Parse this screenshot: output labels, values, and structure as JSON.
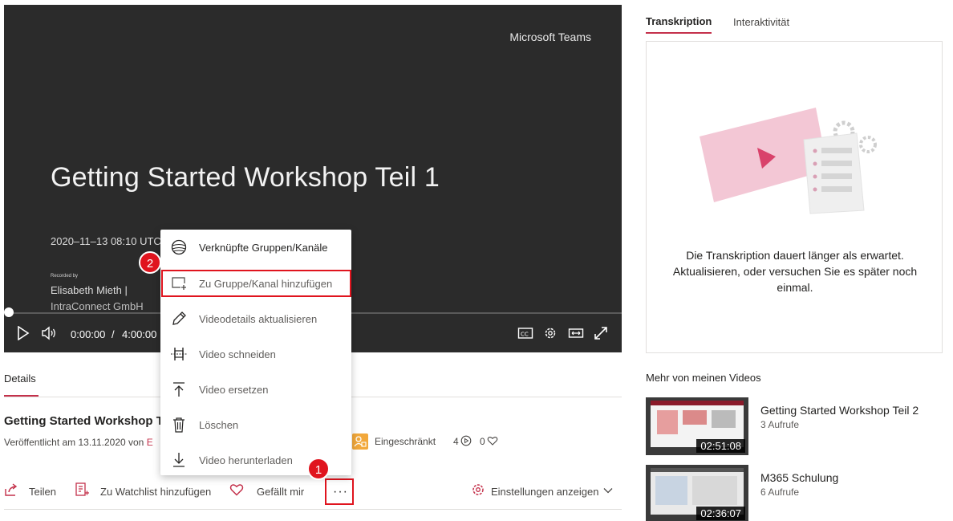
{
  "player": {
    "brand": "Microsoft Teams",
    "slide_title": "Getting Started Workshop Teil 1",
    "slide_date": "2020–11–13 08:10 UTC",
    "recorded_by": "Recorded by",
    "presenter_name": "Elisabeth Mieth |",
    "presenter_org": "IntraConnect GmbH",
    "time_current": "0:00:00",
    "time_separator": "/",
    "time_total": "4:00:00",
    "progress": 0
  },
  "details": {
    "tab_label": "Details",
    "title": "Getting Started Workshop Teil 1",
    "published_prefix": "Veröffentlicht am 13.11.2020 von",
    "published_author": "E",
    "restricted_label": "Eingeschränkt",
    "views": "4",
    "likes": "0"
  },
  "actions": {
    "share": "Teilen",
    "watchlist": "Zu Watchlist hinzufügen",
    "like": "Gefällt mir",
    "more": "···",
    "settings": "Einstellungen anzeigen"
  },
  "menu": {
    "items": [
      {
        "label": "Verknüpfte Gruppen/Kanäle",
        "icon": "globe-icon"
      },
      {
        "label": "Zu Gruppe/Kanal hinzufügen",
        "icon": "add-to-group-icon"
      },
      {
        "label": "Videodetails aktualisieren",
        "icon": "pencil-icon"
      },
      {
        "label": "Video schneiden",
        "icon": "trim-icon"
      },
      {
        "label": "Video ersetzen",
        "icon": "upload-icon"
      },
      {
        "label": "Löschen",
        "icon": "trash-icon"
      },
      {
        "label": "Video herunterladen",
        "icon": "download-icon"
      }
    ]
  },
  "badges": {
    "step1": "1",
    "step2": "2"
  },
  "side": {
    "tab_transcription": "Transkription",
    "tab_interactivity": "Interaktivität",
    "transcript_message": "Die Transkription dauert länger als erwartet. Aktualisieren, oder versuchen Sie es später noch einmal.",
    "more_heading": "Mehr von meinen Videos",
    "videos": [
      {
        "title": "Getting Started Workshop Teil 2",
        "views": "3 Aufrufe",
        "duration": "02:51:08"
      },
      {
        "title": "M365 Schulung",
        "views": "6 Aufrufe",
        "duration": "02:36:07"
      }
    ]
  },
  "colors": {
    "accent": "#c4314b",
    "highlight": "#e0141e",
    "restricted": "#f2a83b"
  }
}
